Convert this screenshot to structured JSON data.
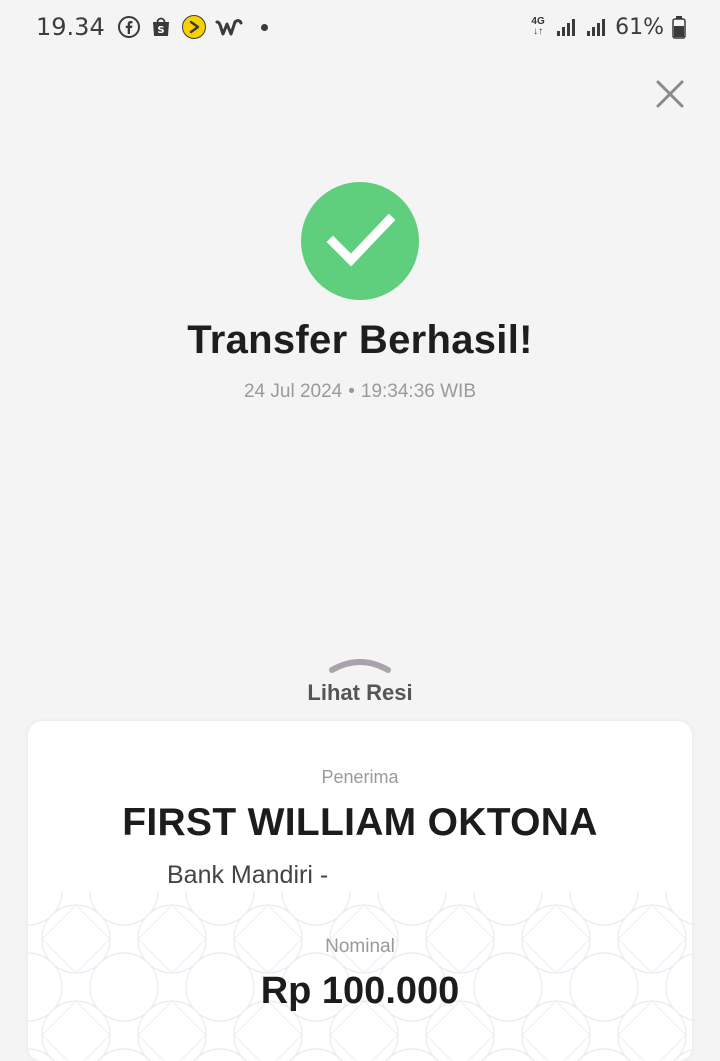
{
  "status_bar": {
    "time": "19.34",
    "apps": [
      "facebook-icon",
      "shopee-icon",
      "play-circle-icon",
      "w-app-icon"
    ],
    "network": "4G",
    "battery_percent": "61%"
  },
  "header": {
    "close_icon": "close-icon"
  },
  "result": {
    "title": "Transfer Berhasil!",
    "date": "24 Jul 2024",
    "separator": "•",
    "time": "19:34:36 WIB",
    "status_color": "#5fcf7d"
  },
  "receipt": {
    "toggle_label": "Lihat Resi",
    "recipient_label": "Penerima",
    "recipient_name": "FIRST WILLIAM OKTONA",
    "recipient_bank": "Bank Mandiri -",
    "amount_label": "Nominal",
    "amount": "Rp 100.000"
  }
}
